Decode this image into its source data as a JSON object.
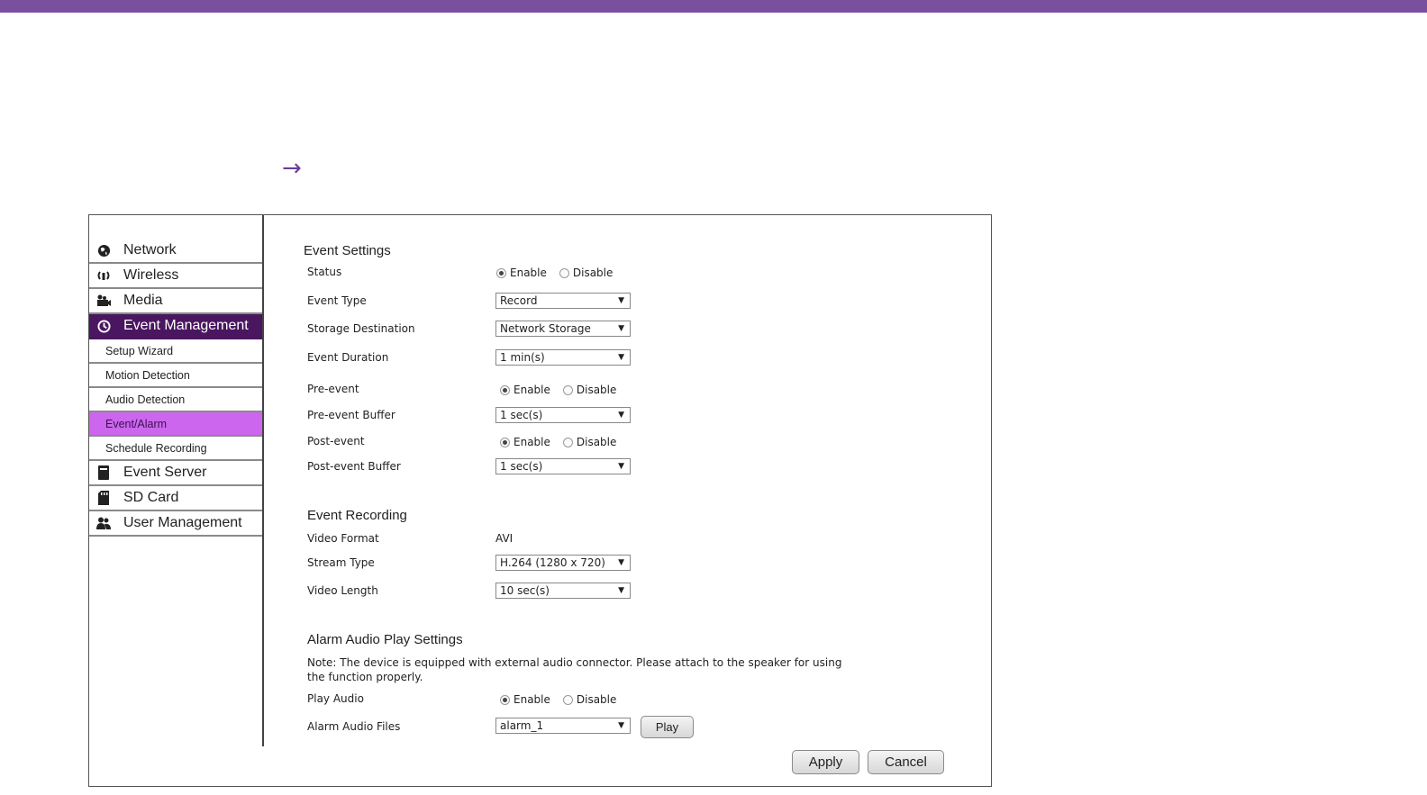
{
  "sidebar": {
    "items": [
      {
        "label": "Network",
        "icon": "globe-icon"
      },
      {
        "label": "Wireless",
        "icon": "wireless-icon"
      },
      {
        "label": "Media",
        "icon": "media-icon"
      },
      {
        "label": "Event Management",
        "icon": "event-management-icon",
        "active": true
      },
      {
        "label": "Event Server",
        "icon": "event-server-icon"
      },
      {
        "label": "SD Card",
        "icon": "sd-card-icon"
      },
      {
        "label": "User Management",
        "icon": "user-management-icon"
      }
    ],
    "subitems": [
      {
        "label": "Setup Wizard"
      },
      {
        "label": "Motion Detection"
      },
      {
        "label": "Audio Detection"
      },
      {
        "label": "Event/Alarm",
        "active": true
      },
      {
        "label": "Schedule Recording"
      }
    ]
  },
  "event_settings": {
    "title": "Event Settings",
    "status_label": "Status",
    "status_enable": "Enable",
    "status_disable": "Disable",
    "status_value": "Enable",
    "event_type_label": "Event Type",
    "event_type_value": "Record",
    "storage_label": "Storage Destination",
    "storage_value": "Network Storage",
    "duration_label": "Event Duration",
    "duration_value": "1 min(s)",
    "pre_event_label": "Pre-event",
    "pre_event_enable": "Enable",
    "pre_event_disable": "Disable",
    "pre_buffer_label": "Pre-event Buffer",
    "pre_buffer_value": "1 sec(s)",
    "post_event_label": "Post-event",
    "post_event_enable": "Enable",
    "post_event_disable": "Disable",
    "post_buffer_label": "Post-event Buffer",
    "post_buffer_value": "1 sec(s)"
  },
  "event_recording": {
    "title": "Event Recording",
    "format_label": "Video Format",
    "format_value": "AVI",
    "stream_label": "Stream Type",
    "stream_value": "H.264 (1280 x 720)",
    "length_label": "Video Length",
    "length_value": "10 sec(s)"
  },
  "alarm_audio": {
    "title": "Alarm Audio Play Settings",
    "note": "Note: The device is equipped with external audio connector. Please attach to the speaker for using the function properly.",
    "play_label": "Play Audio",
    "play_enable": "Enable",
    "play_disable": "Disable",
    "files_label": "Alarm Audio Files",
    "files_value": "alarm_1",
    "play_button": "Play"
  },
  "actions": {
    "apply": "Apply",
    "cancel": "Cancel"
  },
  "colors": {
    "brand": "#7b4fa0",
    "nav_active": "#4a1660",
    "sub_active": "#cc66ee"
  }
}
